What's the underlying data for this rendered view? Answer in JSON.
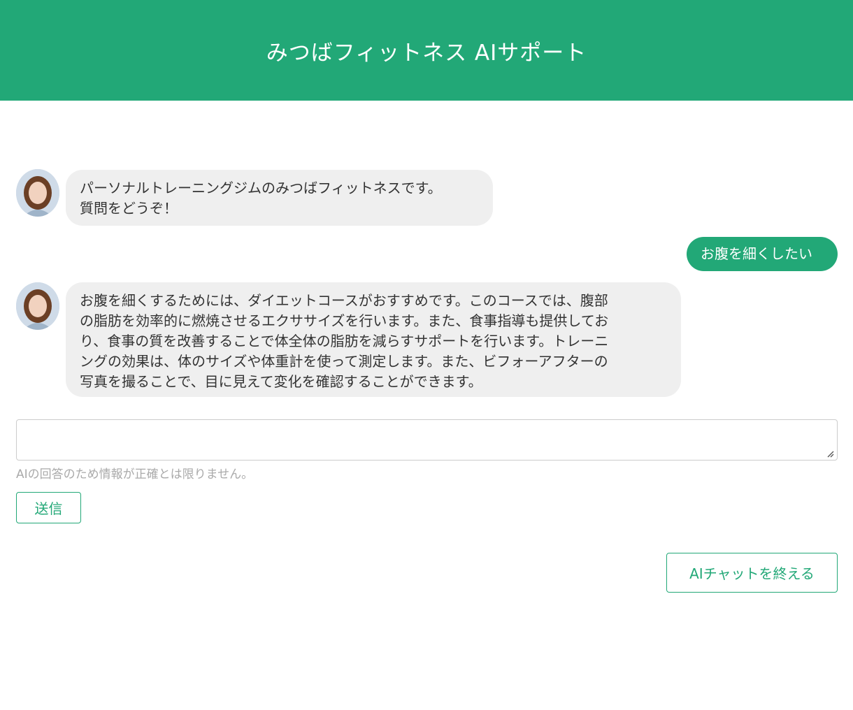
{
  "header": {
    "title": "みつばフィットネス AIサポート"
  },
  "messages": [
    {
      "role": "bot",
      "lines": [
        "パーソナルトレーニングジムのみつばフィットネスです。",
        "質問をどうぞ！"
      ]
    },
    {
      "role": "user",
      "text": "お腹を細くしたい"
    },
    {
      "role": "bot",
      "lines": [
        "お腹を細くするためには、ダイエットコースがおすすめです。このコースでは、腹部",
        "の脂肪を効率的に燃焼させるエクササイズを行います。また、食事指導も提供してお",
        "り、食事の質を改善することで体全体の脂肪を減らすサポートを行います。トレーニ",
        "ングの効果は、体のサイズや体重計を使って測定します。また、ビフォーアフターの",
        "写真を撮ることで、目に見えて変化を確認することができます。"
      ]
    }
  ],
  "input": {
    "value": "",
    "placeholder": ""
  },
  "disclaimer": "AIの回答のため情報が正確とは限りません。",
  "send_label": "送信",
  "end_label": "AIチャットを終える",
  "colors": {
    "brand": "#22a877",
    "bubble_bot": "#efefef"
  },
  "icons": {
    "avatar": "assistant-avatar-photo",
    "resize": "resize-grip-icon"
  }
}
